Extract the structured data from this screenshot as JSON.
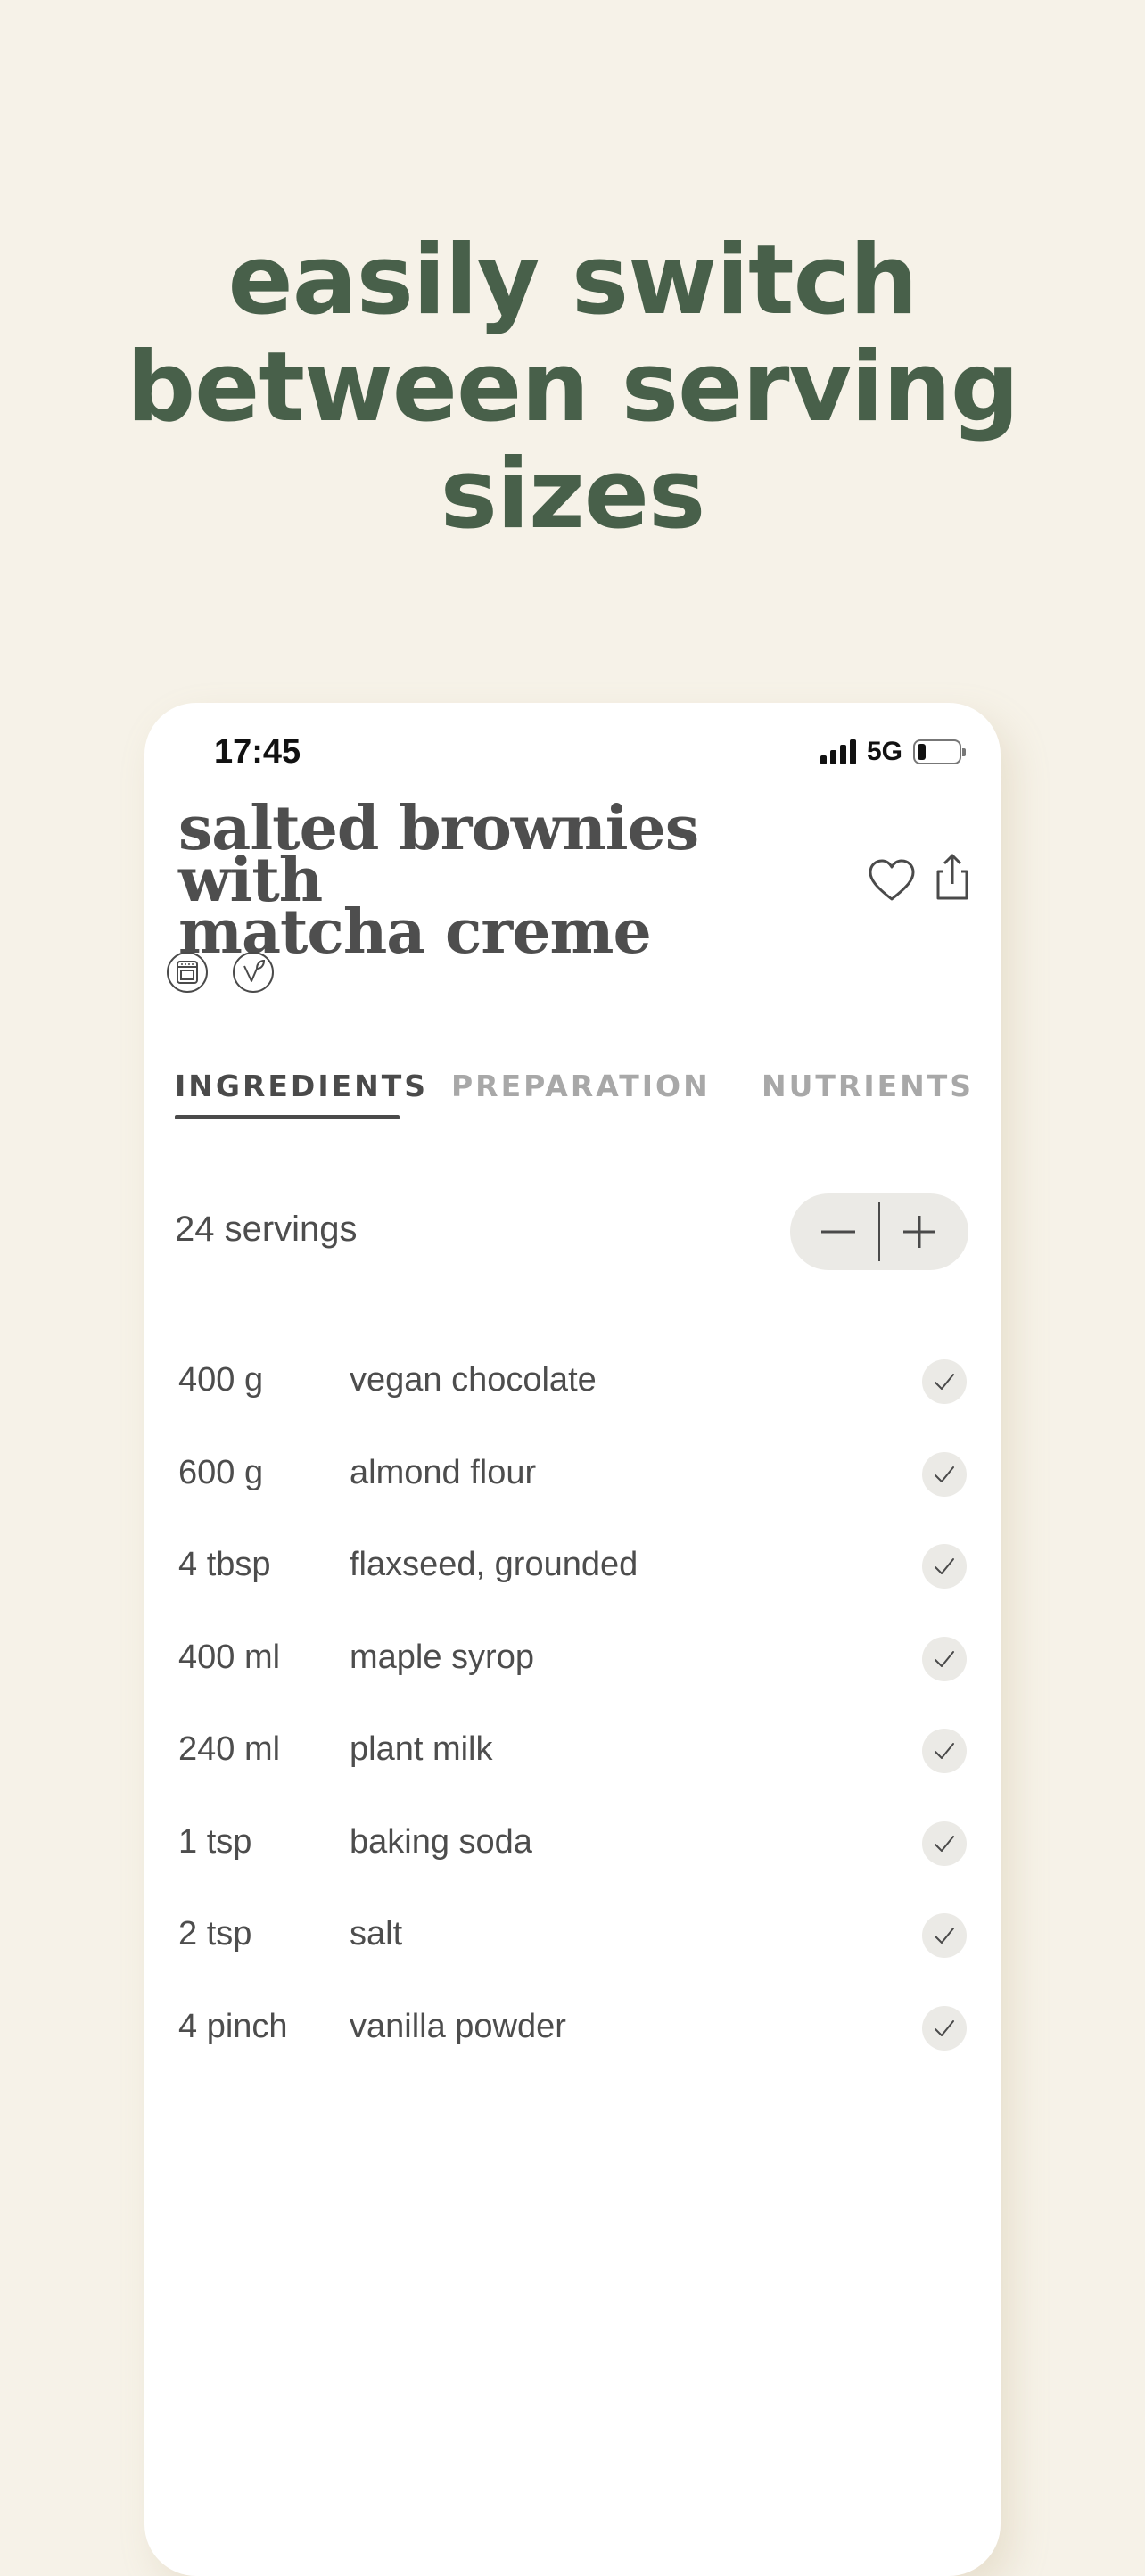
{
  "headline": {
    "line1": "easily switch",
    "line2": "between serving",
    "line3": "sizes"
  },
  "status_bar": {
    "time": "17:45",
    "network": "5G",
    "battery_level": 0.2
  },
  "recipe": {
    "title_line1": "salted brownies with",
    "title_line2": "matcha creme",
    "actions": [
      "heart-icon",
      "share-icon"
    ],
    "tags": [
      "oven-icon",
      "vegan-icon"
    ]
  },
  "tabs": [
    {
      "label": "INGREDIENTS",
      "active": true
    },
    {
      "label": "PREPARATION",
      "active": false
    },
    {
      "label": "NUTRIENTS",
      "active": false
    }
  ],
  "servings": {
    "label": "24 servings",
    "decrement": "minus-icon",
    "increment": "plus-icon"
  },
  "ingredients": [
    {
      "amount": "400 g",
      "name": "vegan chocolate"
    },
    {
      "amount": "600 g",
      "name": "almond flour"
    },
    {
      "amount": "4 tbsp",
      "name": "flaxseed, grounded"
    },
    {
      "amount": "400 ml",
      "name": "maple syrop"
    },
    {
      "amount": "240 ml",
      "name": "plant milk"
    },
    {
      "amount": "1 tsp",
      "name": "baking soda"
    },
    {
      "amount": "2 tsp",
      "name": "salt"
    },
    {
      "amount": "4 pinch",
      "name": "vanilla powder"
    }
  ],
  "colors": {
    "background": "#f6f2e8",
    "headline": "#48604a",
    "card": "#ffffff",
    "text": "#4d4d4d",
    "muted_tab": "#a8a8a8",
    "pill": "#ebeae6"
  }
}
